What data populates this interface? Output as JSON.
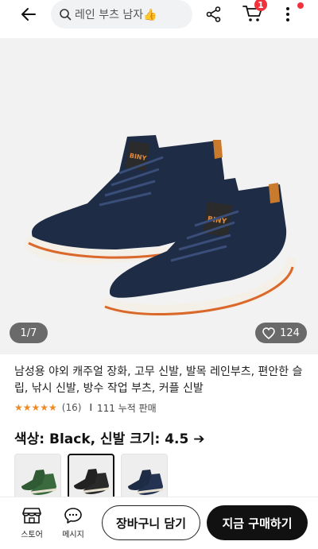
{
  "header": {
    "search_text": "레인 부츠 남자👍",
    "cart_count": "1"
  },
  "gallery": {
    "counter": "1/7",
    "likes": "124"
  },
  "product": {
    "title": "남성용 야외 캐주얼 장화, 고무 신발, 발목 레인부츠, 편안한 슬립, 낚시 신발, 방수 작업 부츠, 커플 신발",
    "rating_value": 4.5,
    "stars": "★★★★★",
    "review_count": "(16)",
    "separator": "I",
    "sold": "111 누적 판매",
    "option_text": "색상: Black, 신발 크기: 4.5 ➔"
  },
  "variants": [
    "green",
    "black",
    "navy"
  ],
  "bottom": {
    "store_label": "스토어",
    "message_label": "메시지",
    "add_to_cart": "장바구니 담기",
    "buy_now": "지금 구매하기"
  },
  "colors": {
    "accent_red": "#f0323c",
    "star_orange": "#f08a24",
    "boot_navy": "#1f2c45",
    "buy_button": "#111111"
  }
}
